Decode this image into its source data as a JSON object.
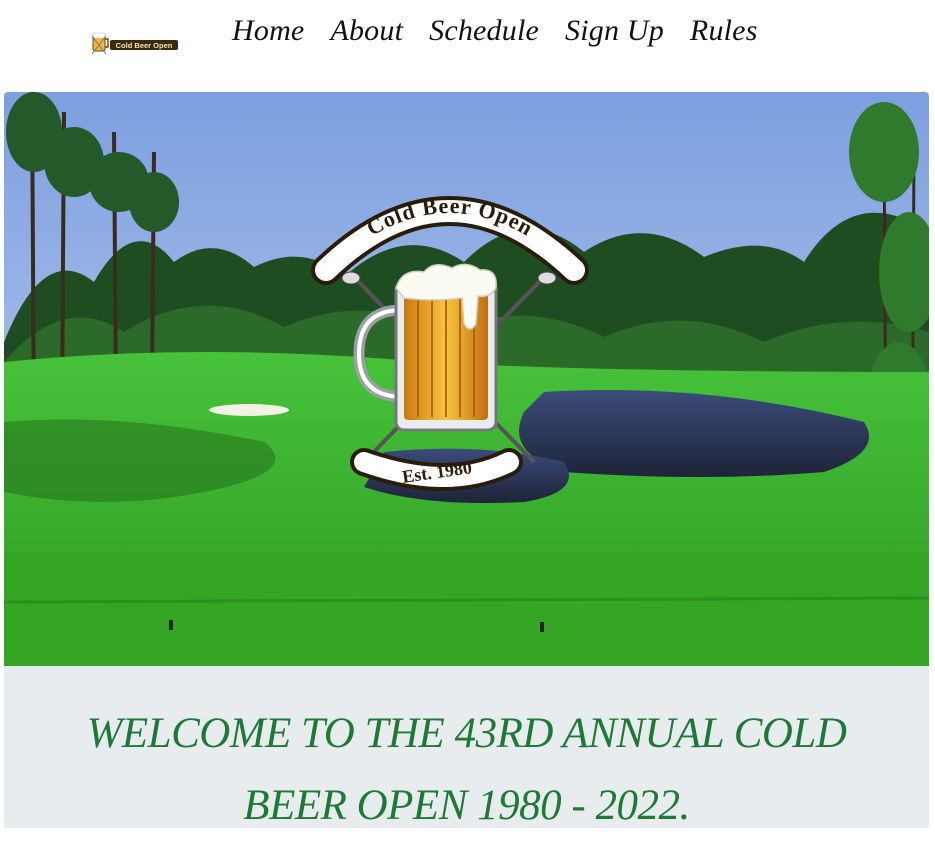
{
  "brand": {
    "logo_text": "Cold Beer Open"
  },
  "nav": {
    "items": [
      {
        "label": "Home"
      },
      {
        "label": "About"
      },
      {
        "label": "Schedule"
      },
      {
        "label": "Sign Up"
      },
      {
        "label": "Rules"
      }
    ]
  },
  "hero": {
    "emblem_title": "Cold Beer Open",
    "emblem_est": "Est. 1980"
  },
  "welcome": {
    "line1": "WELCOME TO THE 43RD ANNUAL COLD",
    "line2": "BEER OPEN 1980 - 2022."
  },
  "colors": {
    "accent_green": "#1d7a36",
    "banner_bg": "#e9ecef"
  }
}
